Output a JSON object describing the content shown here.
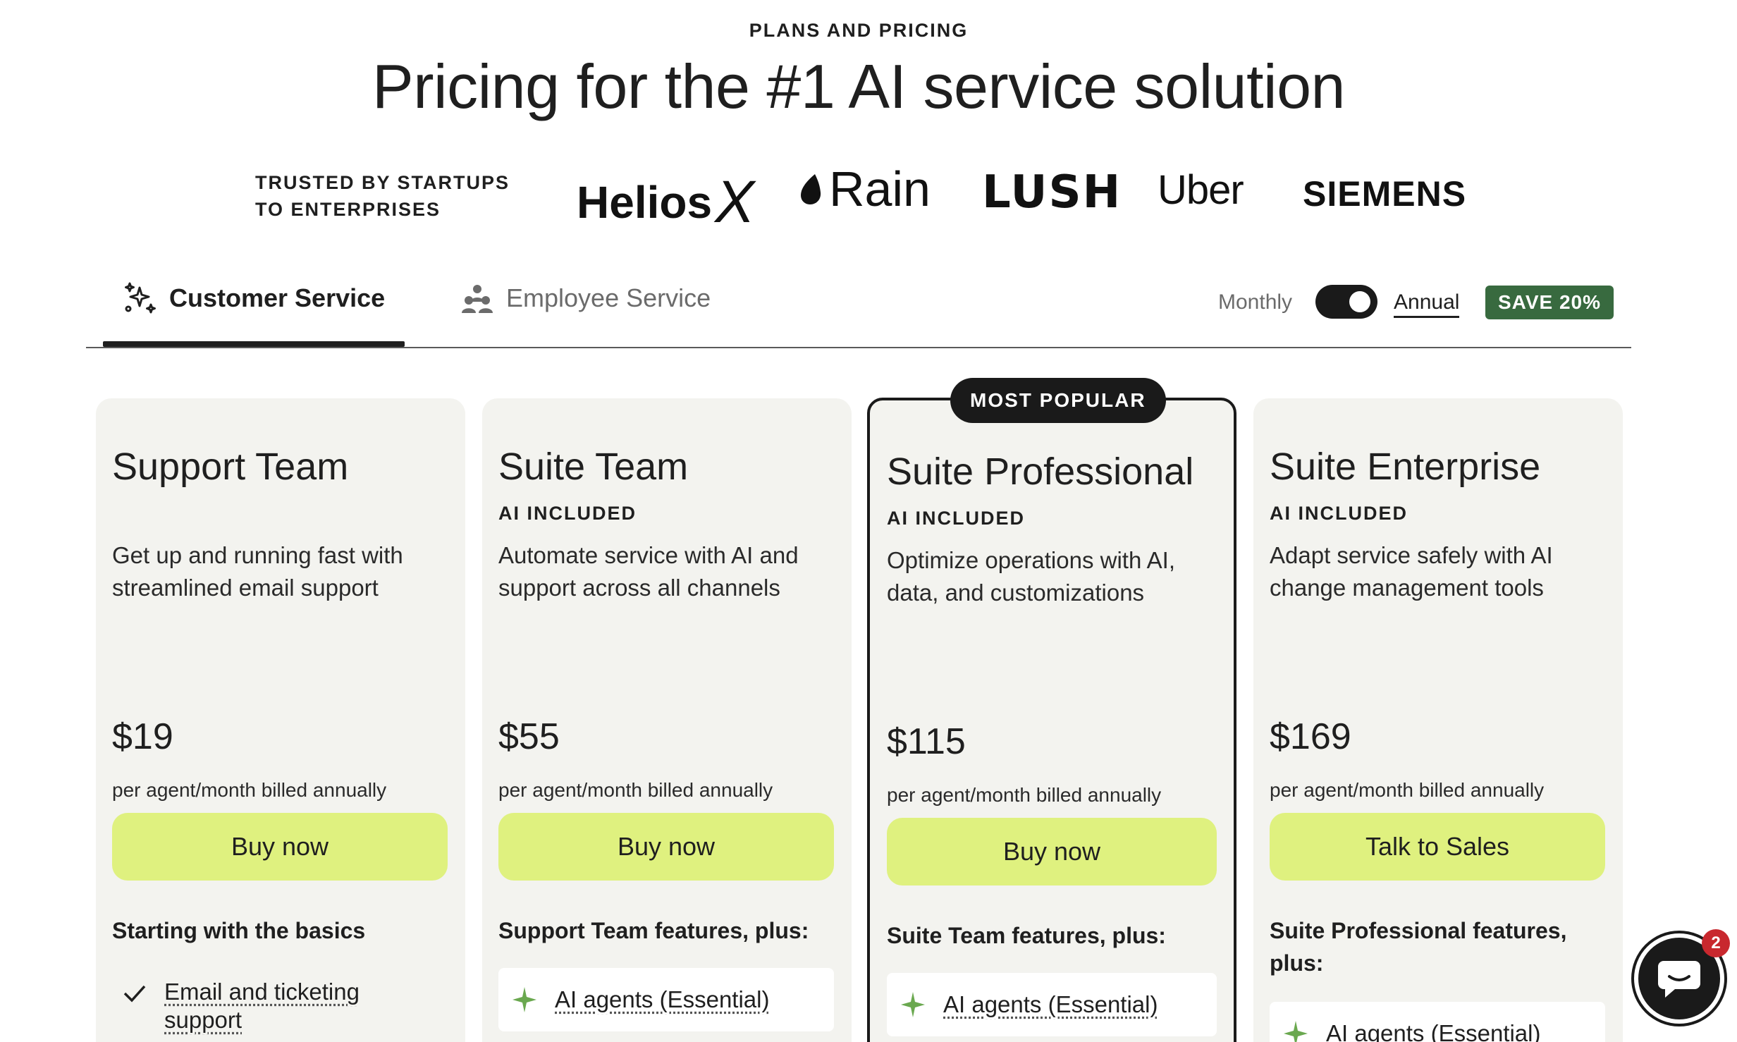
{
  "header": {
    "eyebrow": "PLANS AND PRICING",
    "title": "Pricing for the #1 AI service solution"
  },
  "trusted": {
    "label": "TRUSTED BY STARTUPS TO ENTERPRISES",
    "logos": [
      {
        "name": "helios-x-logo",
        "text": "Helios",
        "suffix": "X"
      },
      {
        "name": "rain-logo",
        "text": "Rain"
      },
      {
        "name": "lush-logo",
        "text": "LUSH"
      },
      {
        "name": "uber-logo",
        "text": "Uber"
      },
      {
        "name": "siemens-logo",
        "text": "SIEMENS"
      }
    ]
  },
  "tabs": [
    {
      "label": "Customer Service",
      "icon": "sparkle-cluster-icon",
      "active": true
    },
    {
      "label": "Employee Service",
      "icon": "people-group-icon",
      "active": false
    }
  ],
  "billing": {
    "monthly_label": "Monthly",
    "annual_label": "Annual",
    "selected": "Annual",
    "save_badge": "SAVE 20%"
  },
  "popular_badge": "MOST POPULAR",
  "plans": [
    {
      "name": "Support Team",
      "ai_included": "",
      "description": "Get up and running fast with streamlined email support",
      "price": "$19",
      "billing_note": "per agent/month billed annually",
      "cta": "Buy now",
      "features_heading": "Starting with the basics",
      "first_feature": "Email and ticketing support"
    },
    {
      "name": "Suite Team",
      "ai_included": "AI INCLUDED",
      "description": "Automate service with AI and support across all channels",
      "price": "$55",
      "billing_note": "per agent/month billed annually",
      "cta": "Buy now",
      "features_heading": "Support Team features, plus:",
      "first_feature": "AI agents (Essential)"
    },
    {
      "name": "Suite Professional",
      "ai_included": "AI INCLUDED",
      "description": "Optimize operations with AI, data, and customizations",
      "price": "$115",
      "billing_note": "per agent/month billed annually",
      "cta": "Buy now",
      "features_heading": "Suite Team features, plus:",
      "first_feature": "AI agents (Essential)"
    },
    {
      "name": "Suite Enterprise",
      "ai_included": "AI INCLUDED",
      "description": "Adapt service safely with AI change management tools",
      "price": "$169",
      "billing_note": "per agent/month billed annually",
      "cta": "Talk to Sales",
      "features_heading": "Suite Professional features, plus:",
      "first_feature": "AI agents (Essential)"
    }
  ],
  "chat": {
    "unread_count": "2",
    "icon": "chat-bubble-icon"
  },
  "colors": {
    "cta_background": "#dff17f",
    "save_badge_background": "#386a3f",
    "card_background": "#f3f3ef",
    "sparkle_icon": "#6aa84f",
    "notification_badge": "#c8282e"
  }
}
